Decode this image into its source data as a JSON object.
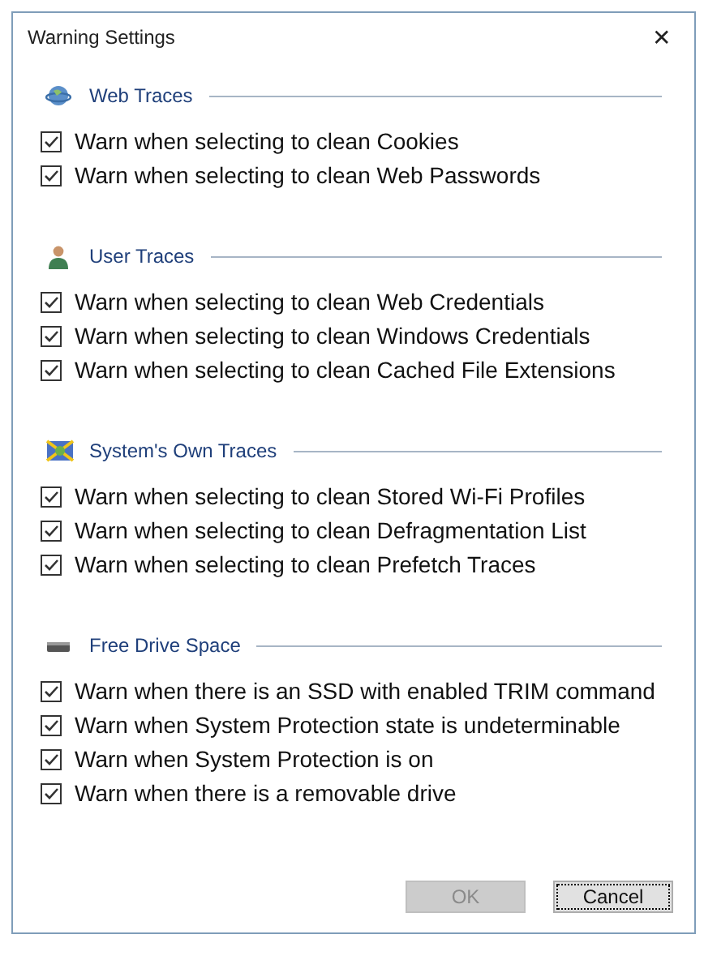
{
  "window": {
    "title": "Warning Settings",
    "close": "✕"
  },
  "sections": [
    {
      "title": "Web Traces",
      "kind": "globe",
      "items": [
        {
          "label": "Warn when selecting to clean Cookies",
          "checked": true
        },
        {
          "label": "Warn when selecting to clean Web Passwords",
          "checked": true
        }
      ]
    },
    {
      "title": "User Traces",
      "kind": "user",
      "items": [
        {
          "label": "Warn when selecting to clean Web Credentials",
          "checked": true
        },
        {
          "label": "Warn when selecting to clean Windows Credentials",
          "checked": true
        },
        {
          "label": "Warn when selecting to clean Cached File Extensions",
          "checked": true
        }
      ]
    },
    {
      "title": "System's Own Traces",
      "kind": "system",
      "items": [
        {
          "label": "Warn when selecting to clean Stored Wi-Fi Profiles",
          "checked": true
        },
        {
          "label": "Warn when selecting to clean Defragmentation List",
          "checked": true
        },
        {
          "label": "Warn when selecting to clean Prefetch Traces",
          "checked": true
        }
      ]
    },
    {
      "title": "Free Drive Space",
      "kind": "drive",
      "items": [
        {
          "label": "Warn when there is an SSD with enabled TRIM command",
          "checked": true
        },
        {
          "label": "Warn when System Protection state is undeterminable",
          "checked": true
        },
        {
          "label": "Warn when System Protection is on",
          "checked": true
        },
        {
          "label": "Warn when there is a removable drive",
          "checked": true
        }
      ]
    }
  ],
  "buttons": [
    {
      "label": "OK",
      "disabled": true,
      "focused": false
    },
    {
      "label": "Cancel",
      "disabled": false,
      "focused": true
    }
  ]
}
